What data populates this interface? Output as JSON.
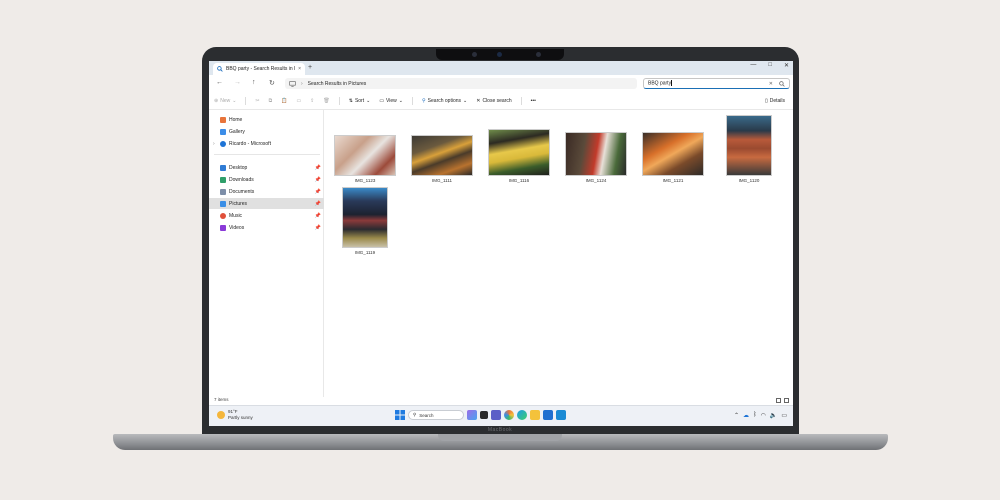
{
  "window": {
    "tab_title": "BBQ party - Search Results in P",
    "tab_close": "×",
    "new_tab": "+",
    "minimize": "—",
    "maximize": "□",
    "close": "✕"
  },
  "address": {
    "path": "Search Results in Pictures",
    "search_value": "BBQ party"
  },
  "commands": {
    "new": "New",
    "sort": "Sort",
    "view": "View",
    "search_options": "Search options",
    "close_search": "Close search",
    "more": "•••",
    "details": "Details"
  },
  "sidebar": {
    "top": [
      {
        "label": "Home",
        "icon": "home-icon",
        "color": "#e8743b"
      },
      {
        "label": "Gallery",
        "icon": "gallery-icon",
        "color": "#3b8de8"
      },
      {
        "label": "Ricardo - Microsoft",
        "icon": "onedrive-icon",
        "color": "#1e74d6"
      }
    ],
    "pinned": [
      {
        "label": "Desktop",
        "icon": "desktop-icon",
        "color": "#2f7bd4"
      },
      {
        "label": "Downloads",
        "icon": "downloads-icon",
        "color": "#2f9f6a"
      },
      {
        "label": "Documents",
        "icon": "documents-icon",
        "color": "#7d8ea8"
      },
      {
        "label": "Pictures",
        "icon": "pictures-icon",
        "color": "#3a8ee6"
      },
      {
        "label": "Music",
        "icon": "music-icon",
        "color": "#e0503a"
      },
      {
        "label": "Videos",
        "icon": "videos-icon",
        "color": "#8a3ad8"
      }
    ]
  },
  "files": [
    {
      "name": "IMG_1123"
    },
    {
      "name": "IMG_1111"
    },
    {
      "name": "IMG_1116"
    },
    {
      "name": "IMG_1124"
    },
    {
      "name": "IMG_1121"
    },
    {
      "name": "IMG_1120"
    },
    {
      "name": "IMG_1119"
    }
  ],
  "status": {
    "item_count": "7 items"
  },
  "taskbar": {
    "weather_temp": "91°F",
    "weather_desc": "Partly sunny",
    "search_label": "Search"
  },
  "brand": "MacBook"
}
